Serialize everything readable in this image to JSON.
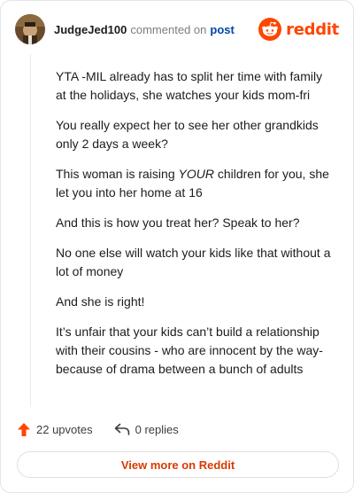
{
  "header": {
    "username": "JudgeJed100",
    "action_text": "commented on",
    "post_link": "post",
    "brand_word": "reddit",
    "brand_icon": "reddit-logo-icon"
  },
  "comment": {
    "p1": "YTA -MIL already has to split her time with family at the holidays, she watches your kids mom-fri",
    "p2": "You really expect her to see her other grandkids only 2 days a week?",
    "p3_before": "This woman is raising ",
    "p3_emphasis": "YOUR",
    "p3_after": " children for you, she let you into her home at 16",
    "p4": "And this is how you treat her? Speak to her?",
    "p5": "No one else will watch your kids like that without a lot of money",
    "p6": "And she is right!",
    "p7": "It’s unfair that your kids can’t build a relationship with their cousins - who are innocent by the way- because of drama between a bunch of adults"
  },
  "footer": {
    "upvotes": "22 upvotes",
    "replies": "0 replies",
    "upvote_icon": "upvote-arrow-icon",
    "reply_icon": "reply-arrow-icon"
  },
  "cta": {
    "label": "View more on Reddit"
  },
  "colors": {
    "accent": "#ff4500",
    "link": "#0045ac",
    "cta_text": "#d93a00"
  }
}
